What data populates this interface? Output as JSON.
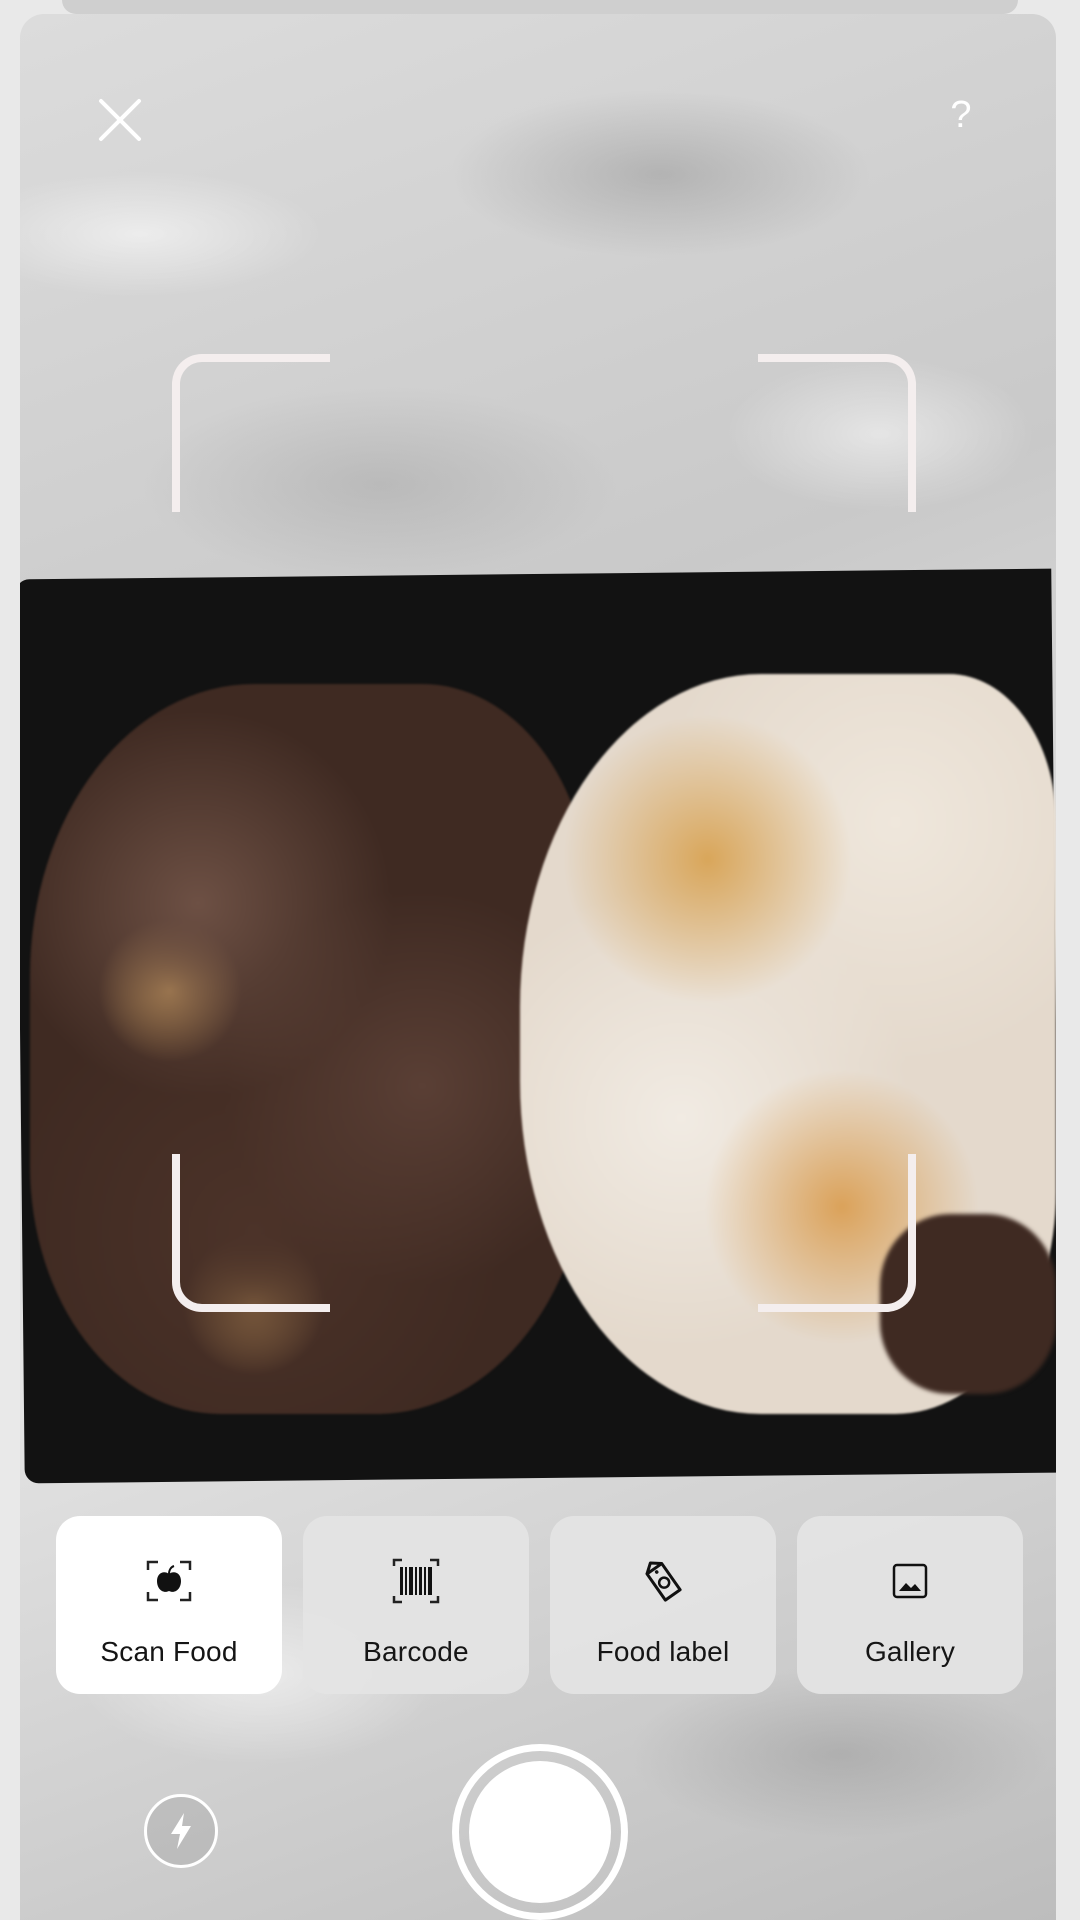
{
  "camera": {
    "close_icon": "close-icon",
    "help_label": "?",
    "help_icon": "help-icon"
  },
  "modes": [
    {
      "label": "Scan Food",
      "icon": "apple-scan-icon",
      "selected": true
    },
    {
      "label": "Barcode",
      "icon": "barcode-icon",
      "selected": false
    },
    {
      "label": "Food label",
      "icon": "food-label-icon",
      "selected": false
    },
    {
      "label": "Gallery",
      "icon": "gallery-icon",
      "selected": false
    }
  ],
  "controls": {
    "flash_icon": "flash-icon",
    "shutter_icon": "shutter-button"
  },
  "colors": {
    "tile_active": "#ffffff",
    "tile_inactive": "#e4e4e4",
    "frame": "#f4eeee",
    "label_text": "#151515"
  }
}
